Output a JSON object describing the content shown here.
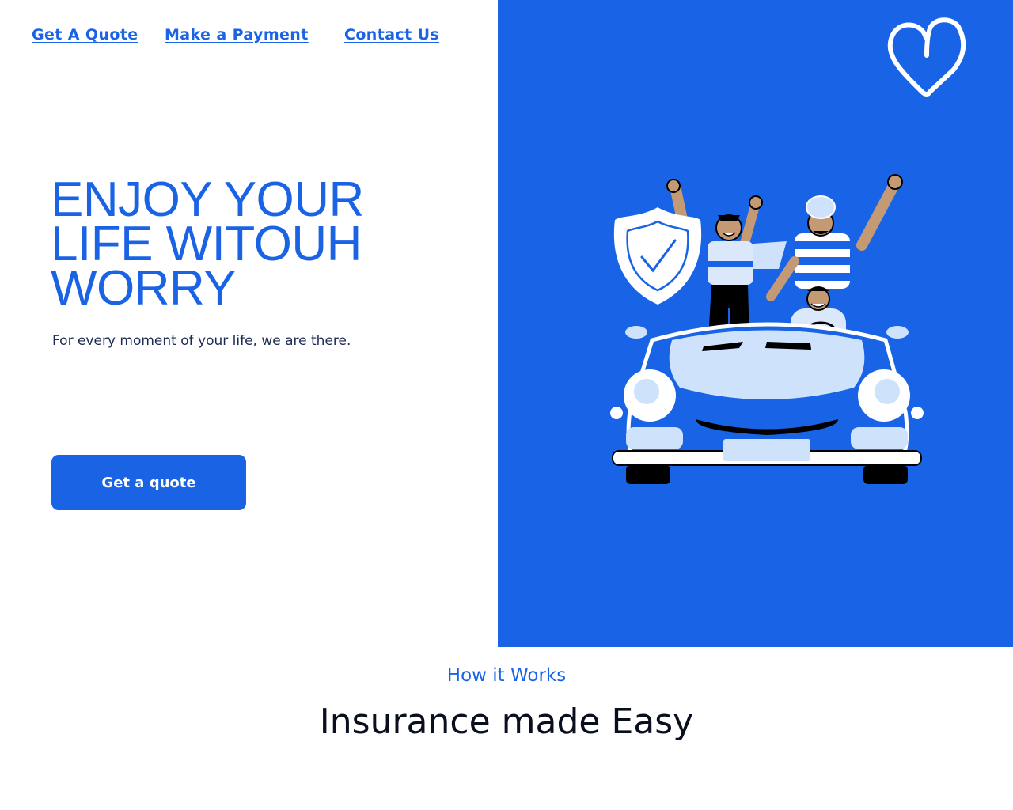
{
  "nav": {
    "get_quote": "Get A Quote",
    "make_payment": "Make a Payment",
    "contact": "Contact Us"
  },
  "hero": {
    "title": "ENJOY YOUR\nLIFE WITOUH\nWORRY",
    "subtitle": "For every moment of your life, we are there.",
    "cta_label": "Get a quote"
  },
  "illustration": {
    "logo_icon": "heart-icon",
    "scene": "friends-in-convertible-car-with-shield"
  },
  "section": {
    "kicker": "How it Works",
    "title": "Insurance made Easy"
  },
  "colors": {
    "accent": "#1a63e5",
    "panel": "#1963e6",
    "light_blue": "#cfe2fc",
    "dark": "#0a0f1f"
  }
}
